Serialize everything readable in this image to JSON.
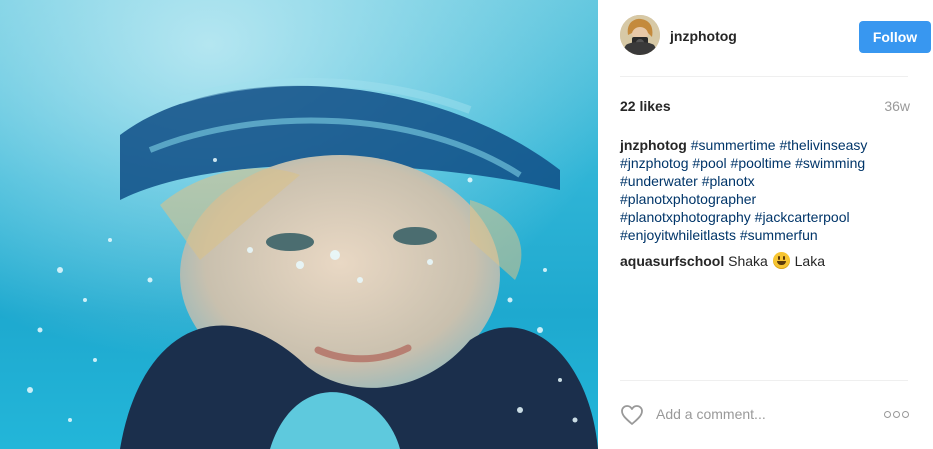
{
  "post": {
    "username": "jnzphotog",
    "follow_label": "Follow",
    "likes": "22 likes",
    "age": "36w",
    "caption": {
      "username": "jnzphotog",
      "lines": [
        "#summertime #thelivinseasy",
        "#jnzphotog #pool #pooltime #swimming",
        "#underwater #planotx",
        "#planotxphotographer",
        "#planotxphotography #jackcarterpool",
        "#enjoyitwhileitlasts #summerfun"
      ]
    },
    "comments": [
      {
        "username": "aquasurfschool",
        "text_before": "Shaka",
        "emoji": "grinning-face-emoji",
        "text_after": "Laka"
      }
    ],
    "comment_placeholder": "Add a comment...",
    "icons": {
      "like": "heart-icon",
      "more": "more-options-icon"
    },
    "colors": {
      "follow_button": "#3897f0",
      "hashtag": "#003569",
      "muted": "#999999"
    }
  }
}
